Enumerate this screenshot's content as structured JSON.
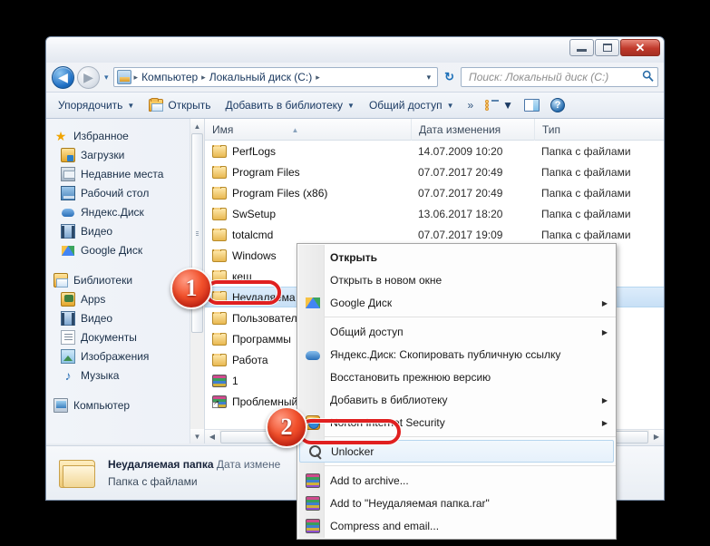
{
  "window": {
    "controls": {
      "minimize": "minimize-button",
      "maximize": "maximize-button",
      "close": "✕"
    }
  },
  "nav": {
    "back_glyph": "◀",
    "forward_glyph": "▶",
    "history_glyph": "▾",
    "breadcrumbs": [
      "Компьютер",
      "Локальный диск (C:)"
    ],
    "separator": "▸",
    "dropdown_glyph": "▾",
    "refresh_glyph": "↻",
    "search_placeholder": "Поиск: Локальный диск (C:)",
    "search_value": "",
    "search_glyph": "🔍"
  },
  "commandbar": {
    "organize": "Упорядочить",
    "open": "Открыть",
    "add_to_library": "Добавить в библиотеку",
    "share": "Общий доступ",
    "overflow": "»",
    "caret": "▼",
    "view_caret": "▼"
  },
  "sidebar": {
    "groups": [
      {
        "root": "Избранное",
        "root_icon": "star-icon",
        "items": [
          {
            "label": "Загрузки",
            "icon": "downloads-icon"
          },
          {
            "label": "Недавние места",
            "icon": "recent-places-icon"
          },
          {
            "label": "Рабочий стол",
            "icon": "desktop-icon"
          },
          {
            "label": "Яндекс.Диск",
            "icon": "yandex-disk-icon"
          },
          {
            "label": "Видео",
            "icon": "video-icon"
          },
          {
            "label": "Google Диск",
            "icon": "google-drive-icon"
          }
        ]
      },
      {
        "root": "Библиотеки",
        "root_icon": "libraries-icon",
        "items": [
          {
            "label": "Apps",
            "icon": "apps-icon"
          },
          {
            "label": "Видео",
            "icon": "video-icon"
          },
          {
            "label": "Документы",
            "icon": "documents-icon"
          },
          {
            "label": "Изображения",
            "icon": "pictures-icon"
          },
          {
            "label": "Музыка",
            "icon": "music-icon"
          }
        ]
      },
      {
        "root": "Компьютер",
        "root_icon": "computer-icon",
        "items": []
      }
    ],
    "scroll_up": "▲",
    "scroll_down": "▼"
  },
  "filelist": {
    "columns": [
      "Имя",
      "Дата изменения",
      "Тип"
    ],
    "rows": [
      {
        "name": "PerfLogs",
        "date": "14.07.2009 10:20",
        "type": "Папка с файлами",
        "icon": "folder-icon",
        "selected": false
      },
      {
        "name": "Program Files",
        "date": "07.07.2017 20:49",
        "type": "Папка с файлами",
        "icon": "folder-icon",
        "selected": false
      },
      {
        "name": "Program Files (x86)",
        "date": "07.07.2017 20:49",
        "type": "Папка с файлами",
        "icon": "folder-icon",
        "selected": false
      },
      {
        "name": "SwSetup",
        "date": "13.06.2017 18:20",
        "type": "Папка с файлами",
        "icon": "folder-icon",
        "selected": false
      },
      {
        "name": "totalcmd",
        "date": "07.07.2017 19:09",
        "type": "Папка с файлами",
        "icon": "folder-icon",
        "selected": false
      },
      {
        "name": "Windows",
        "date": "",
        "type": "йлами",
        "icon": "folder-icon",
        "selected": false
      },
      {
        "name": "кеш",
        "date": "",
        "type": "йлами",
        "icon": "folder-icon",
        "selected": false
      },
      {
        "name": "Неудаляема",
        "date": "",
        "type": "йлами",
        "icon": "folder-icon",
        "selected": true
      },
      {
        "name": "Пользователи",
        "date": "",
        "type": "йлами",
        "icon": "folder-icon",
        "selected": false
      },
      {
        "name": "Программы",
        "date": "",
        "type": "йлами",
        "icon": "folder-icon",
        "selected": false
      },
      {
        "name": "Работа",
        "date": "",
        "type": "йлами",
        "icon": "folder-icon",
        "selected": false
      },
      {
        "name": "1",
        "date": "",
        "type": "hive",
        "icon": "rar-archive-icon",
        "selected": false
      },
      {
        "name": "Проблемный",
        "date": "",
        "type": "",
        "icon": "rar-shortcut-icon",
        "selected": false
      }
    ],
    "hscroll_left": "◀",
    "hscroll_right": "▶"
  },
  "details": {
    "name": "Неудаляемая папка",
    "meta": "Дата измене",
    "subtitle": "Папка с файлами"
  },
  "context_menu": {
    "items": [
      {
        "label": "Открыть",
        "bold": true,
        "icon": null,
        "submenu": false,
        "separator_after": false,
        "highlight": false
      },
      {
        "label": "Открыть в новом окне",
        "bold": false,
        "icon": null,
        "submenu": false,
        "separator_after": false,
        "highlight": false
      },
      {
        "label": "Google Диск",
        "bold": false,
        "icon": "google-drive-icon",
        "submenu": true,
        "separator_after": true,
        "highlight": false
      },
      {
        "label": "Общий доступ",
        "bold": false,
        "icon": null,
        "submenu": true,
        "separator_after": false,
        "highlight": false
      },
      {
        "label": "Яндекс.Диск: Скопировать публичную ссылку",
        "bold": false,
        "icon": "yandex-disk-icon",
        "submenu": false,
        "separator_after": false,
        "highlight": false
      },
      {
        "label": "Восстановить прежнюю версию",
        "bold": false,
        "icon": null,
        "submenu": false,
        "separator_after": false,
        "highlight": false
      },
      {
        "label": "Добавить в библиотеку",
        "bold": false,
        "icon": null,
        "submenu": true,
        "separator_after": false,
        "highlight": false
      },
      {
        "label": "Norton Internet Security",
        "bold": false,
        "icon": "norton-icon",
        "submenu": true,
        "separator_after": true,
        "highlight": false
      },
      {
        "label": "Unlocker",
        "bold": false,
        "icon": "unlocker-icon",
        "submenu": false,
        "separator_after": true,
        "highlight": true
      },
      {
        "label": "Add to archive...",
        "bold": false,
        "icon": "rar-archive-icon",
        "submenu": false,
        "separator_after": false,
        "highlight": false
      },
      {
        "label": "Add to \"Неудаляемая папка.rar\"",
        "bold": false,
        "icon": "rar-archive-icon",
        "submenu": false,
        "separator_after": false,
        "highlight": false
      },
      {
        "label": "Compress and email...",
        "bold": false,
        "icon": "rar-archive-icon",
        "submenu": false,
        "separator_after": false,
        "highlight": false
      }
    ],
    "submenu_arrow": "▶"
  },
  "callouts": [
    {
      "number": "1"
    },
    {
      "number": "2"
    }
  ],
  "colors": {
    "accent_red": "#e02020",
    "selection_blue": "#c8e0f6",
    "titlebar": "#eef1f6",
    "close_button": "#c0392b"
  }
}
